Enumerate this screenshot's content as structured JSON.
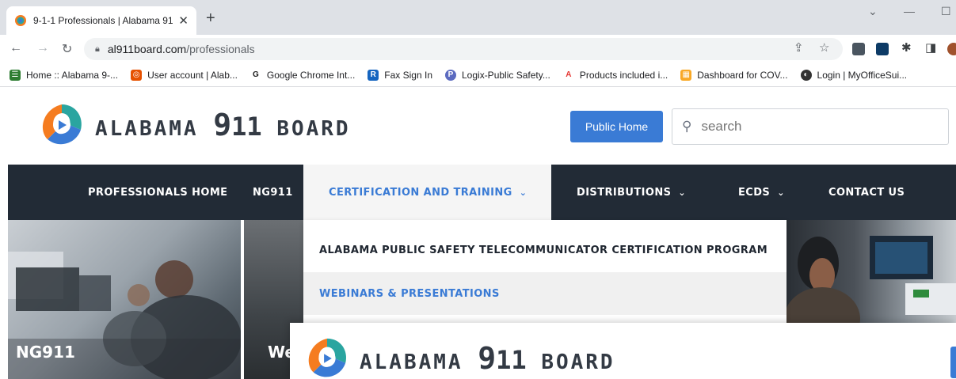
{
  "browser": {
    "tab_title": "9-1-1 Professionals | Alabama 91",
    "new_tab": "+",
    "url_host": "al911board.com",
    "url_path": "/professionals",
    "bookmarks": [
      {
        "label": "Home :: Alabama 9-...",
        "color": "#2e7d32",
        "glyph": "☰"
      },
      {
        "label": "User account | Alab...",
        "color": "#e65100",
        "glyph": "◎"
      },
      {
        "label": "Google Chrome Int...",
        "color": "#ffffff",
        "glyph": "G"
      },
      {
        "label": "Fax Sign In",
        "color": "#1565c0",
        "glyph": "R"
      },
      {
        "label": "Logix-Public Safety...",
        "color": "#5c6bc0",
        "glyph": "P"
      },
      {
        "label": "Products included i...",
        "color": "#ffffff",
        "glyph": "A"
      },
      {
        "label": "Dashboard for COV...",
        "color": "#f9a825",
        "glyph": "▦"
      },
      {
        "label": "Login | MyOfficeSui...",
        "color": "#333333",
        "glyph": "◐"
      }
    ]
  },
  "site": {
    "logo_text_left": "ALABAMA",
    "logo_nine": "9",
    "logo_eleven": "11",
    "logo_text_right": "BOARD",
    "public_home": "Public Home",
    "search_placeholder": "search"
  },
  "nav": {
    "items": [
      {
        "label": "PROFESSIONALS HOME"
      },
      {
        "label": "NG911"
      },
      {
        "label": "CERTIFICATION AND TRAINING",
        "chevron": "⌄"
      },
      {
        "label": "DISTRIBUTIONS",
        "chevron": "⌄"
      },
      {
        "label": "ECDS",
        "chevron": "⌄"
      },
      {
        "label": "CONTACT US"
      }
    ]
  },
  "dropdown": {
    "items": [
      {
        "label": "ALABAMA PUBLIC SAFETY TELECOMMUNICATOR CERTIFICATION PROGRAM"
      },
      {
        "label": "WEBINARS & PRESENTATIONS"
      }
    ]
  },
  "tiles": {
    "ng911": "NG911",
    "partial": "We"
  },
  "colors": {
    "accent": "#3a7bd5",
    "nav_bg": "#222b36"
  }
}
